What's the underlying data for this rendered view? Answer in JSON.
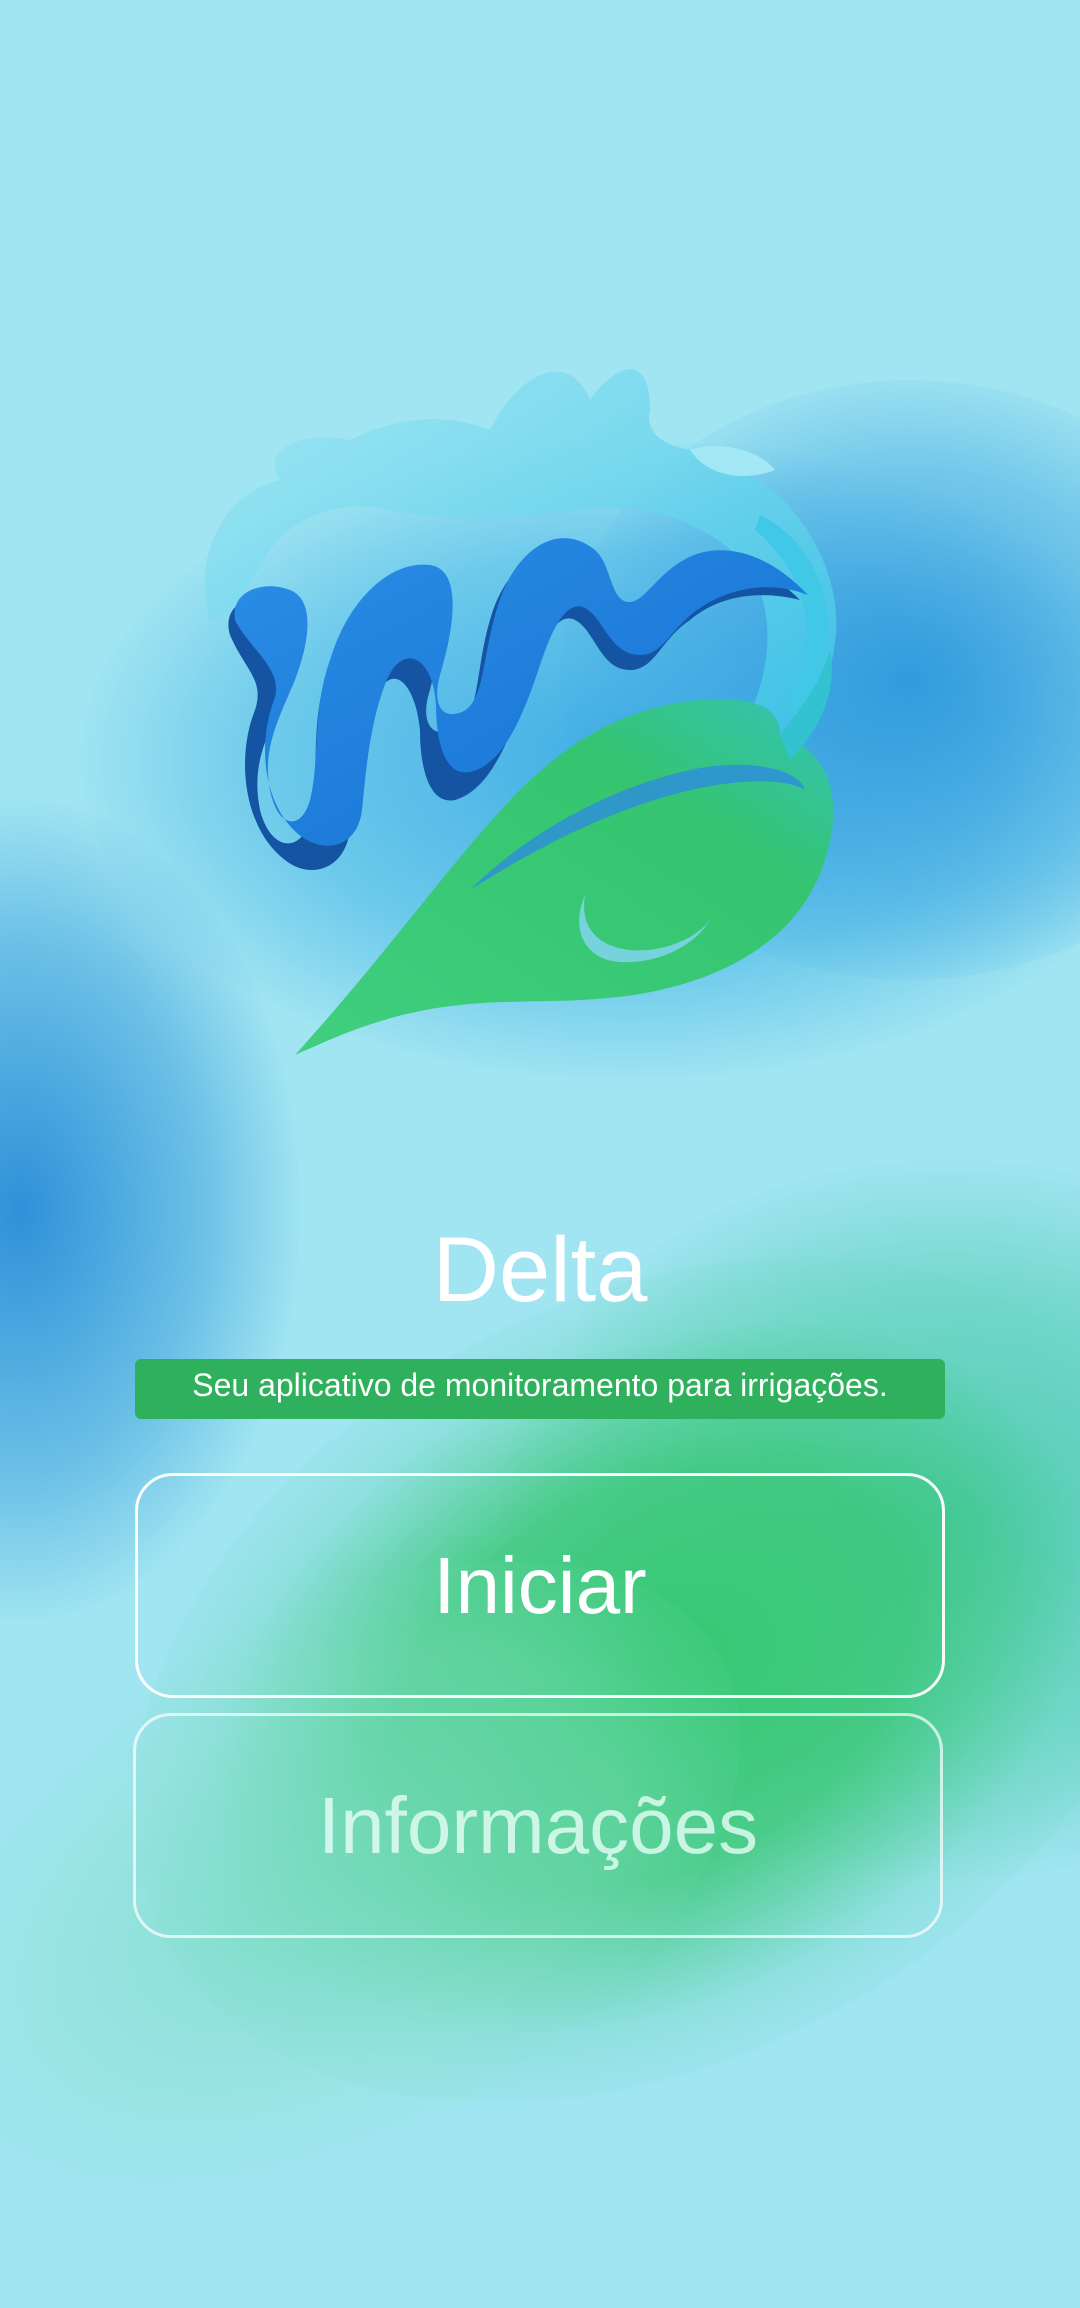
{
  "app": {
    "title": "Delta",
    "tagline": "Seu aplicativo de monitoramento para irrigações.",
    "logo_icon": "water-splash-leaf-logo"
  },
  "buttons": {
    "start_label": "Iniciar",
    "info_label": "Informações",
    "info_state": "disabled"
  },
  "colors": {
    "background": "#a1e5f2",
    "tagline_bg": "#2fb05c",
    "water_dark": "#1458a8",
    "water_mid": "#1f7fdc",
    "water_light": "#3cc6e8",
    "leaf_green": "#36c676",
    "text": "#ffffff"
  }
}
